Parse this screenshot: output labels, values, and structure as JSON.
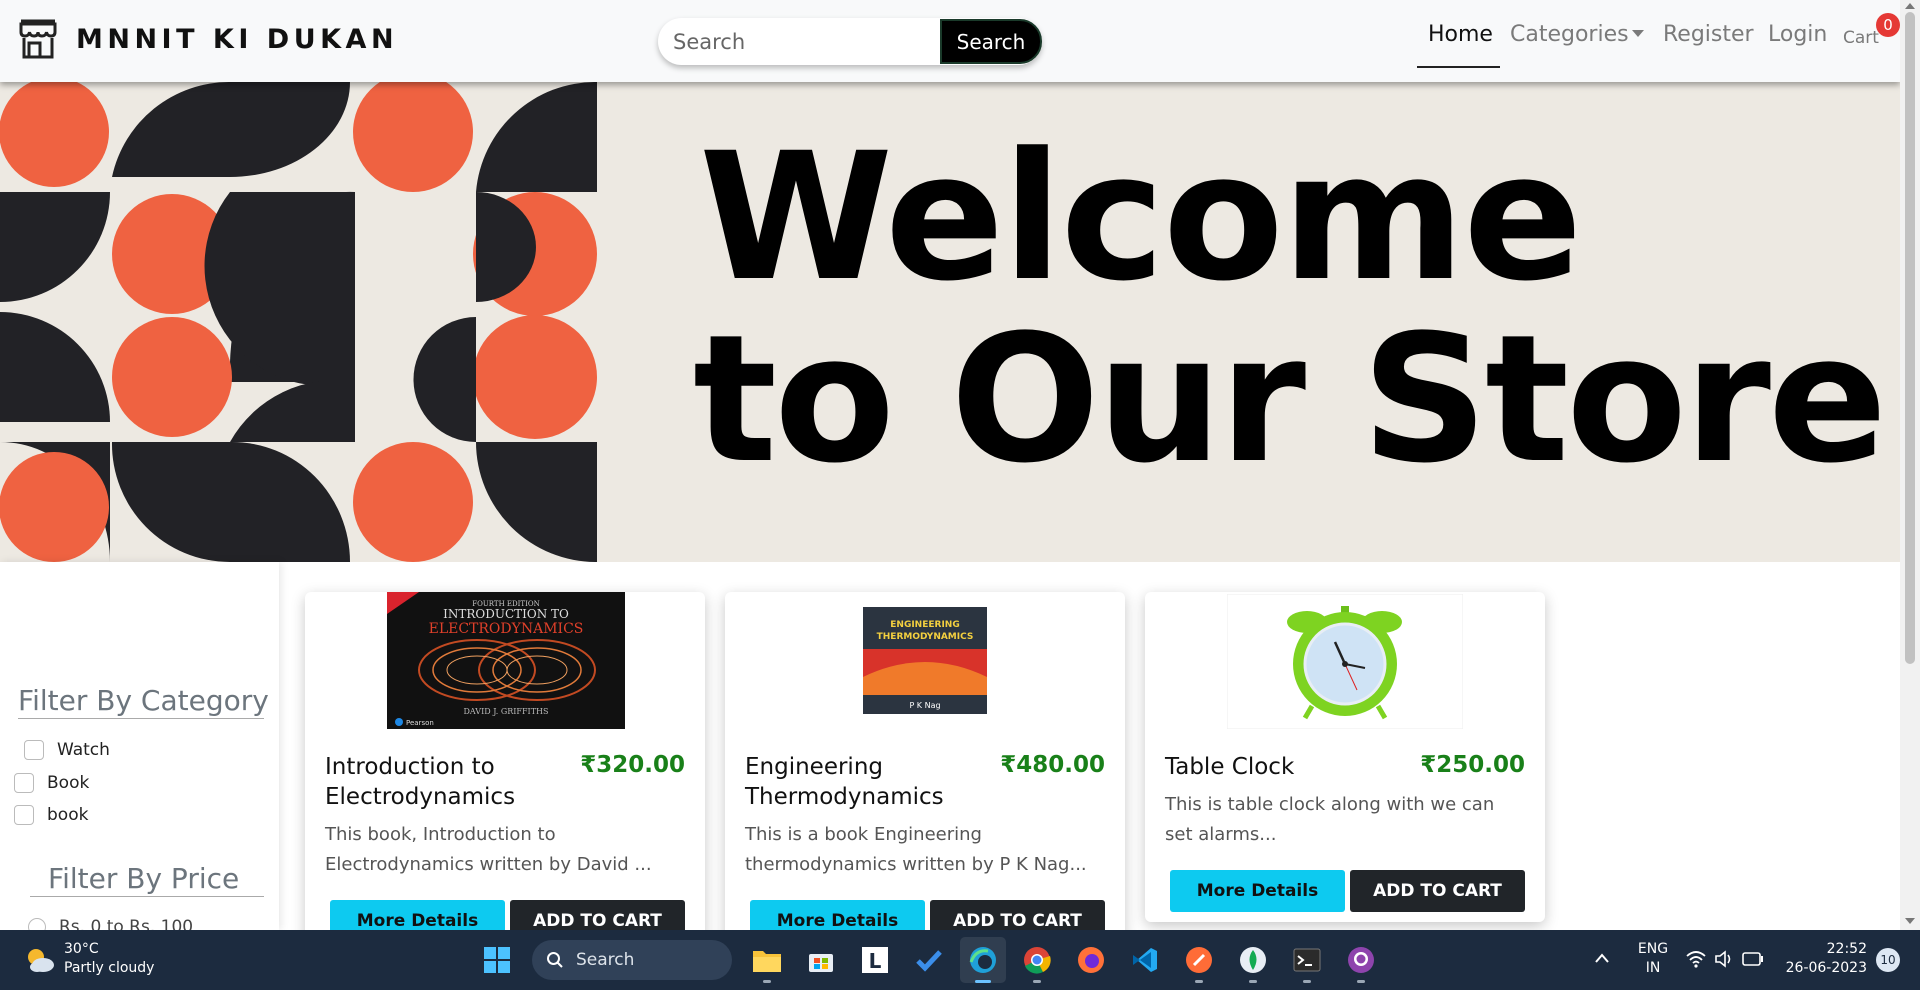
{
  "navbar": {
    "brand": "MNNIT KI DUKAN",
    "search_placeholder": "Search",
    "search_button": "Search",
    "links": {
      "home": "Home",
      "categories": "Categories",
      "register": "Register",
      "login": "Login",
      "cart": "Cart"
    },
    "cart_count": "0"
  },
  "banner": {
    "line1": "Welcome",
    "line2": "to Our Store",
    "colors": {
      "bg": "#ede9e2",
      "orange": "#ef6241",
      "dark": "#222226"
    }
  },
  "filters": {
    "category_title": "Filter By Category",
    "categories": [
      "Watch",
      "Book",
      "book"
    ],
    "price_title": "Filter By Price",
    "price_options": [
      "Rs. 0 to Rs. 100"
    ]
  },
  "products": [
    {
      "title": "Introduction to Electrodynamics",
      "price": "₹320.00",
      "desc": "This book, Introduction to Electrodynamics written by David ...",
      "more_label": "More Details",
      "cart_label": "ADD TO CART",
      "cover_lines": [
        "FOURTH EDITION",
        "INTRODUCTION TO",
        "ELECTRODYNAMICS",
        "DAVID J. GRIFFITHS",
        "Pearson"
      ]
    },
    {
      "title": "Engineering Thermodynamics",
      "price": "₹480.00",
      "desc": "This is a book Engineering thermodynamics written by P K Nag...",
      "more_label": "More Details",
      "cart_label": "ADD TO CART",
      "cover_lines": [
        "ENGINEERING",
        "THERMODYNAMICS",
        "P K Nag"
      ]
    },
    {
      "title": "Table Clock",
      "price": "₹250.00",
      "desc": "This is table clock along with we can set alarms...",
      "more_label": "More Details",
      "cart_label": "ADD TO CART"
    }
  ],
  "taskbar": {
    "weather_temp": "30°C",
    "weather_desc": "Partly cloudy",
    "search_label": "Search",
    "lang_line1": "ENG",
    "lang_line2": "IN",
    "time": "22:52",
    "date": "26-06-2023",
    "notifications": "10"
  },
  "colors": {
    "price_green": "#198019",
    "more_button": "#0dcaf0",
    "cart_button": "#212529",
    "badge_red": "#e53935",
    "taskbar": "#1c2b3f"
  }
}
